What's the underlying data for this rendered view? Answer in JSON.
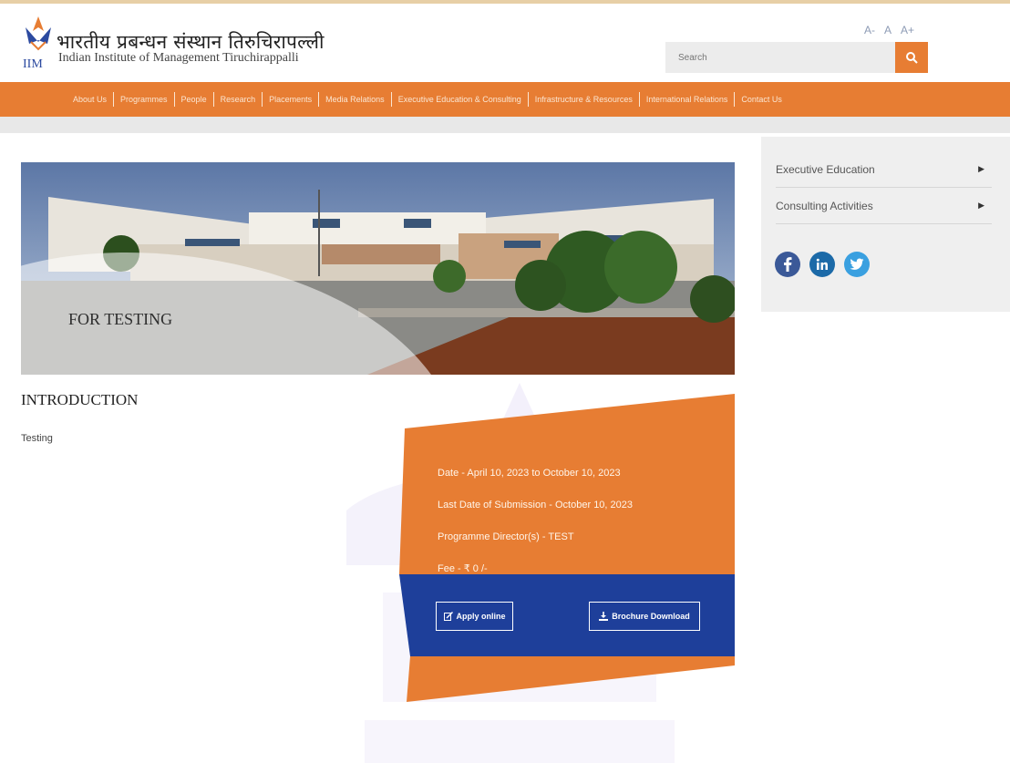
{
  "header": {
    "institute_hindi": "भारतीय प्रबन्धन संस्थान तिरुचिरापल्ली",
    "institute_english": "Indian Institute of Management Tiruchirappalli",
    "logo_text": "IIM",
    "font_sizes": [
      "A-",
      "A",
      "A+"
    ],
    "search_placeholder": "Search"
  },
  "nav": {
    "items": [
      "About Us",
      "Programmes",
      "People",
      "Research",
      "Placements",
      "Media Relations",
      "Executive Education & Consulting",
      "Infrastructure & Resources",
      "International Relations",
      "Contact Us"
    ]
  },
  "banner": {
    "title": "FOR TESTING"
  },
  "intro": {
    "heading": "INTRODUCTION",
    "text": "Testing"
  },
  "details": {
    "date": "Date - April 10, 2023 to October 10, 2023",
    "last_date": "Last Date of Submission - October 10, 2023",
    "director": "Programme Director(s) - TEST",
    "fee": "Fee - ₹ 0 /-"
  },
  "buttons": {
    "apply": "Apply online",
    "brochure": "Brochure Download"
  },
  "sidebar": {
    "items": [
      {
        "label": "Executive Education"
      },
      {
        "label": "Consulting Activities"
      }
    ]
  },
  "social": [
    "facebook-icon",
    "linkedin-icon",
    "twitter-icon"
  ],
  "colors": {
    "accent_orange": "#e77d33",
    "apply_band_blue": "#1e3f9a",
    "sidebar_bg": "#efefef",
    "facebook": "#3b5998",
    "linkedin": "#1c6aa8",
    "twitter": "#3aa0e0"
  }
}
